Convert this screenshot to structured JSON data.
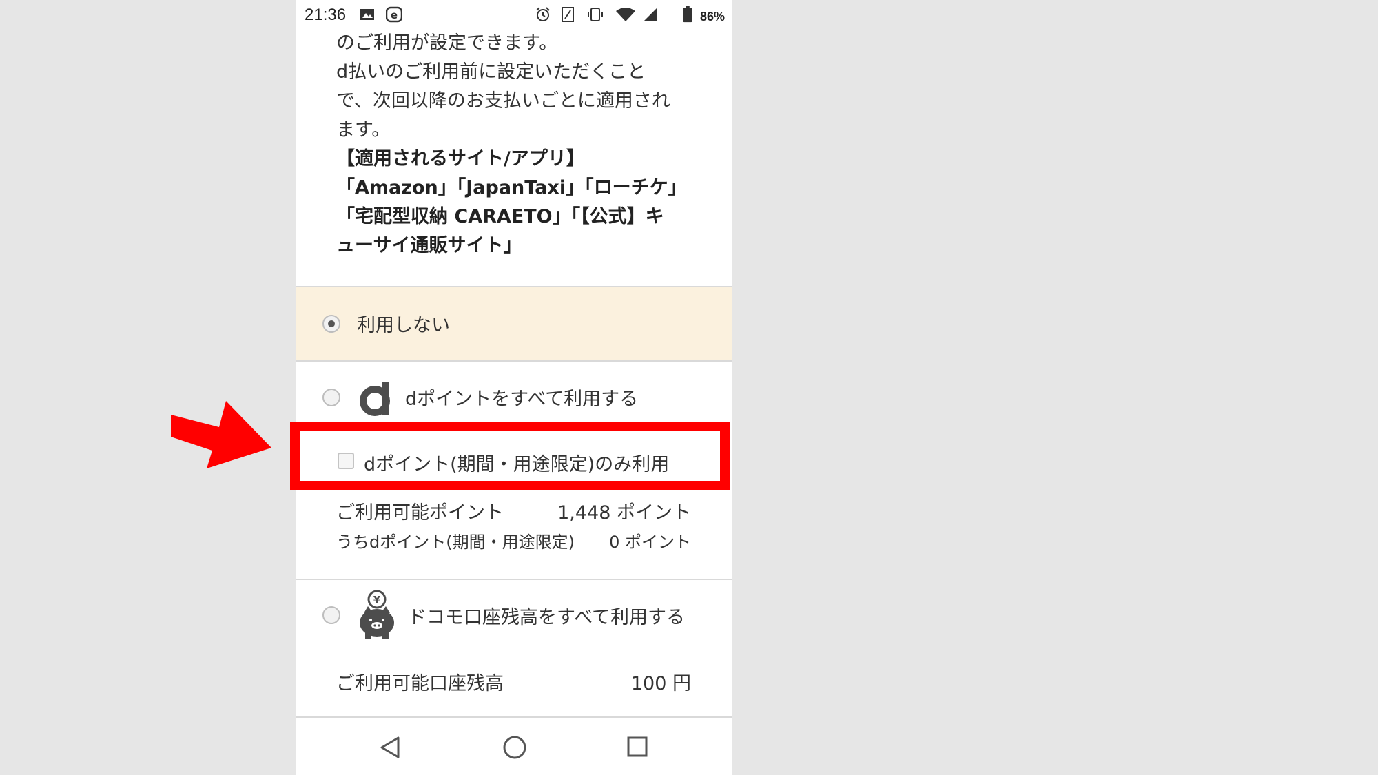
{
  "status": {
    "time": "21:36",
    "battery": "86%"
  },
  "description": {
    "lines": [
      "のご利用が設定できます。",
      "d払いのご利用前に設定いただくこと",
      "で、次回以降のお支払いごとに適用され",
      "ます。"
    ],
    "sites_heading": "【適用されるサイト/アプリ】",
    "sites_lines": [
      "「Amazon」「JapanTaxi」「ローチケ」",
      "「宅配型収納 CARAETO」「【公式】キ",
      "ューサイ通販サイト」"
    ]
  },
  "options": {
    "none_label": "利用しない",
    "dpoint_label": "dポイントをすべて利用する",
    "dpoint_limited_label": "dポイント(期間・用途限定)のみ利用",
    "available_points_label": "ご利用可能ポイント",
    "available_points_value": "1,448 ポイント",
    "limited_points_label": "うちdポイント(期間・用途限定)",
    "limited_points_value": "0 ポイント",
    "docomo_label": "ドコモ口座残高をすべて利用する",
    "available_balance_label": "ご利用可能口座残高",
    "available_balance_value": "100 円"
  },
  "colors": {
    "selected_bg": "#fbf1de",
    "highlight": "#ff0000",
    "dlogo": "#4d4d4d"
  }
}
